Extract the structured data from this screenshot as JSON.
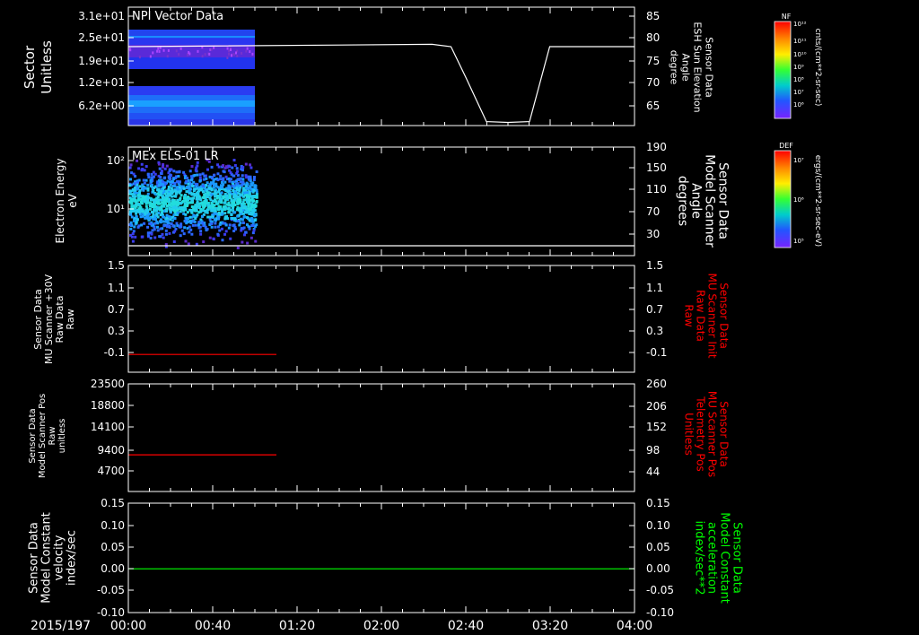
{
  "date_label": "2015/197",
  "time_ticks": [
    "00:00",
    "00:40",
    "01:20",
    "02:00",
    "02:40",
    "03:20",
    "04:00"
  ],
  "colors": {
    "background": "#000000",
    "axis": "#ffffff",
    "red_trace": "#ff0000",
    "green_trace": "#00ff00",
    "right_label_red": "#ff0000",
    "right_label_green": "#00ff00"
  },
  "colorbars": [
    {
      "tag": "NF",
      "unit": "cnts/(cm**2-sr-sec)",
      "ticks": [
        "10¹²",
        "10¹¹",
        "10¹⁰",
        "10⁹",
        "10⁸",
        "10⁷",
        "10⁶"
      ]
    },
    {
      "tag": "DEF",
      "unit": "ergs/(cm**2-sr-sec-eV)",
      "ticks": [
        "10⁷",
        "10⁶",
        "10⁵"
      ]
    }
  ],
  "chart_data": [
    {
      "type": "heatmap",
      "title": "NPI Vector Data",
      "ylabel": [
        "Sector",
        "Unitless"
      ],
      "yticks": [
        "3.1e+01",
        "2.5e+01",
        "1.9e+01",
        "1.2e+01",
        "6.2e+00"
      ],
      "right_axis": {
        "label": [
          "Sensor Data",
          "ESH Sun Elevation",
          "Angle",
          "degree"
        ],
        "ticks": [
          85,
          80,
          75,
          70,
          65
        ],
        "ylim": [
          60,
          85
        ],
        "line": {
          "x_hours": [
            0.0,
            2.4,
            2.55,
            2.67,
            2.83,
            3.0,
            3.17,
            3.33,
            4.0
          ],
          "y": [
            80.0,
            80.6,
            80.0,
            72.0,
            61.0,
            60.8,
            61.0,
            80.0,
            80.0
          ]
        }
      },
      "data_extent_hours": [
        0.0,
        1.0
      ]
    },
    {
      "type": "heatmap",
      "title": "MEx ELS-01 LR",
      "ylabel": [
        "Electron Energy",
        "eV"
      ],
      "yticks": [
        "10²",
        "10¹"
      ],
      "right_axis": {
        "label": [
          "Sensor Data",
          "Model Scanner",
          "Angle",
          "degrees"
        ],
        "ticks": [
          190,
          150,
          110,
          70,
          30
        ],
        "ylim": [
          0,
          190
        ],
        "line": {
          "x_hours": [
            0.0,
            4.0
          ],
          "y": [
            5,
            5
          ]
        }
      },
      "data_extent_hours": [
        0.0,
        1.0
      ]
    },
    {
      "type": "line",
      "ylabel": [
        "Sensor Data",
        "MU Scanner +30V",
        "Raw Data",
        "Raw"
      ],
      "yticks": [
        "1.5",
        "1.1",
        "0.7",
        "0.3",
        "-0.1"
      ],
      "ylim": [
        -0.3,
        1.5
      ],
      "right_axis": {
        "label": [
          "Sensor Data",
          "MU Scanner Init",
          "Raw Data",
          "Raw"
        ],
        "ticks": [
          "1.5",
          "1.1",
          "0.7",
          "0.3",
          "-0.1"
        ]
      },
      "series": [
        {
          "x_hours": [
            0.0,
            1.17
          ],
          "y": [
            0.0,
            0.0
          ],
          "color": "#ff0000"
        }
      ]
    },
    {
      "type": "line",
      "ylabel": [
        "Sensor Data",
        "Model Scanner Pos",
        "Raw",
        "unitless"
      ],
      "yticks": [
        "23500",
        "18800",
        "14100",
        "9400",
        "4700"
      ],
      "ylim": [
        0,
        23500
      ],
      "right_axis": {
        "label": [
          "Sensor Data",
          "MU Scanner Pos",
          "Telemetry Pos",
          "Unitless"
        ],
        "ticks": [
          "260",
          "206",
          "152",
          "98",
          "44"
        ]
      },
      "series": [
        {
          "x_hours": [
            0.0,
            1.17
          ],
          "y": [
            8000,
            8000
          ],
          "color": "#ff0000"
        }
      ]
    },
    {
      "type": "line",
      "ylabel": [
        "Sensor Data",
        "Model Constant",
        "velocity",
        "index/sec"
      ],
      "yticks": [
        "0.15",
        "0.10",
        "0.05",
        "0.00",
        "-0.05",
        "-0.10"
      ],
      "ylim": [
        -0.1,
        0.15
      ],
      "right_axis": {
        "label": [
          "Sensor Data",
          "Model Constant",
          "acceleration",
          "index/sec**2"
        ],
        "ticks": [
          "0.15",
          "0.10",
          "0.05",
          "0.00",
          "-0.05",
          "-0.10"
        ]
      },
      "series": [
        {
          "x_hours": [
            0.0,
            4.0
          ],
          "y": [
            0.0,
            0.0
          ],
          "color": "#00ff00"
        }
      ]
    }
  ]
}
